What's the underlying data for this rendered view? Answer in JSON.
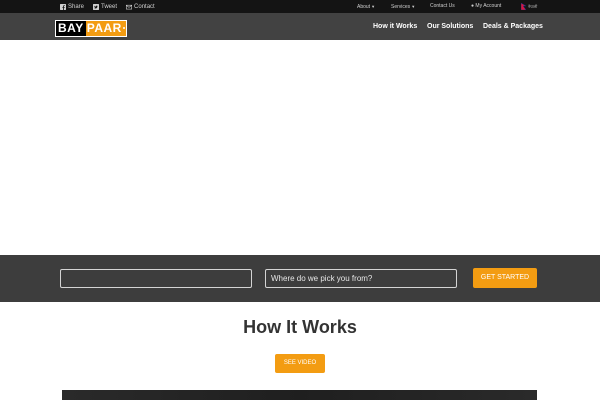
{
  "topbar": {
    "social": [
      {
        "label": "Share",
        "icon": "facebook-icon"
      },
      {
        "label": "Tweet",
        "icon": "twitter-icon"
      },
      {
        "label": "Contact",
        "icon": "mail-icon"
      }
    ],
    "nav": {
      "about": "About",
      "services": "Services",
      "contact": "Contact Us",
      "account": "My Account",
      "language": "नेपाली"
    }
  },
  "brand": {
    "part1": "BAY",
    "part2": "PAAR"
  },
  "main_nav": {
    "how_it_works": "How it Works",
    "solutions": "Our Solutions",
    "deals": "Deals & Packages"
  },
  "search": {
    "drop_value": "",
    "pickup_placeholder": "Where do we pick you from?",
    "cta": "GET STARTED"
  },
  "how_section": {
    "title": "How It Works",
    "video_button": "SEE VIDEO"
  },
  "colors": {
    "accent": "#f39c12",
    "topbar": "#141414",
    "mainbar": "#424242",
    "band": "#3d3d3d"
  }
}
